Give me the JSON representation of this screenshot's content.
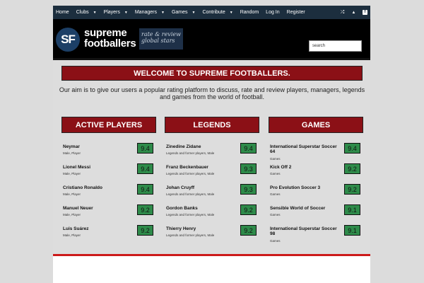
{
  "nav": {
    "items": [
      {
        "label": "Home",
        "dropdown": false
      },
      {
        "label": "Clubs",
        "dropdown": true
      },
      {
        "label": "Players",
        "dropdown": true
      },
      {
        "label": "Managers",
        "dropdown": true
      },
      {
        "label": "Games",
        "dropdown": true
      },
      {
        "label": "Contribute",
        "dropdown": true
      },
      {
        "label": "Random",
        "dropdown": false
      },
      {
        "label": "Log In",
        "dropdown": false
      },
      {
        "label": "Register",
        "dropdown": false
      }
    ],
    "caret": "▼",
    "icons": {
      "shuffle": "⤮",
      "twitter": "🐦",
      "facebook": "f"
    }
  },
  "header": {
    "logo_initials": "SF",
    "logo_line1": "supreme",
    "logo_line2": "footballers",
    "tagline_line1": "rate & review",
    "tagline_line2": "global stars",
    "search_value": "search"
  },
  "welcome": "WELCOME TO SUPREME FOOTBALLERS.",
  "aim": "Our aim is to give our users a popular rating platform to discuss, rate and review players, managers, legends and games from the world of football.",
  "columns": [
    {
      "title": "ACTIVE PLAYERS",
      "rows": [
        {
          "name": "Neymar",
          "sub": "Male, Player",
          "score": "9.4"
        },
        {
          "name": "Lionel Messi",
          "sub": "Male, Player",
          "score": "9.4"
        },
        {
          "name": "Cristiano Ronaldo",
          "sub": "Male, Player",
          "score": "9.4"
        },
        {
          "name": "Manuel Neuer",
          "sub": "Male, Player",
          "score": "9.2"
        },
        {
          "name": "Luis Suárez",
          "sub": "Male, Player",
          "score": "9.2"
        }
      ]
    },
    {
      "title": "LEGENDS",
      "rows": [
        {
          "name": "Zinedine Zidane",
          "sub": "Legends and former players, Male",
          "score": "9.4"
        },
        {
          "name": "Franz Beckenbauer",
          "sub": "Legends and former players, Male",
          "score": "9.3"
        },
        {
          "name": "Johan Cruyff",
          "sub": "Legends and former players, Male",
          "score": "9.3"
        },
        {
          "name": "Gordon Banks",
          "sub": "Legends and former players, Male",
          "score": "9.2"
        },
        {
          "name": "Thierry Henry",
          "sub": "Legends and former players, Male",
          "score": "9.2"
        }
      ]
    },
    {
      "title": "GAMES",
      "rows": [
        {
          "name": "International Superstar Soccer 64",
          "sub": "Games",
          "score": "9.4",
          "two_line": true
        },
        {
          "name": "Kick Off 2",
          "sub": "Games",
          "score": "9.2"
        },
        {
          "name": "Pro Evolution Soccer 3",
          "sub": "Games",
          "score": "9.2"
        },
        {
          "name": "Sensible World of Soccer",
          "sub": "Games",
          "score": "9.1"
        },
        {
          "name": "International Superstar Soccer 98",
          "sub": "Games",
          "score": "9.1",
          "two_line": true
        }
      ]
    }
  ],
  "colors": {
    "nav_bg": "#1c2e3e",
    "accent_red": "#8b1016",
    "score_green": "#2e8b4a",
    "rule_red": "#cc1a1a"
  }
}
